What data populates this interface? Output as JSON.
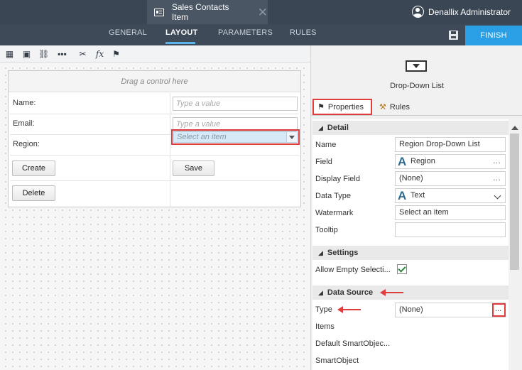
{
  "header": {
    "document_title": "Sales Contacts Item",
    "user_name": "Denallix Administrator"
  },
  "nav": {
    "tabs": [
      {
        "label": "GENERAL",
        "active": false
      },
      {
        "label": "LAYOUT",
        "active": true
      },
      {
        "label": "PARAMETERS",
        "active": false
      },
      {
        "label": "RULES",
        "active": false
      }
    ],
    "finish_label": "FINISH",
    "accent_color": "#2a9fe6"
  },
  "toolbar": {
    "icons": [
      "table-icon",
      "image-icon",
      "link-icon",
      "more-icon",
      "tools-icon",
      "fx-icon",
      "theme-icon"
    ],
    "fx_glyph": "fx"
  },
  "canvas": {
    "drop_hint": "Drag a control here",
    "fields": [
      {
        "label": "Name:",
        "placeholder": "Type a value"
      },
      {
        "label": "Email:",
        "placeholder": "Type a value"
      },
      {
        "label": "Region:",
        "placeholder": "Select an item"
      }
    ],
    "buttons": {
      "create": "Create",
      "save": "Save",
      "delete": "Delete"
    }
  },
  "panel": {
    "control_type": "Drop-Down List",
    "tabs": {
      "properties": "Properties",
      "rules": "Rules"
    },
    "sections": {
      "detail": "Detail",
      "settings": "Settings",
      "data_source": "Data Source"
    },
    "detail": [
      {
        "label": "Name",
        "value": "Region Drop-Down List"
      },
      {
        "label": "Field",
        "value": "Region",
        "glyph": "A"
      },
      {
        "label": "Display Field",
        "value": "(None)"
      },
      {
        "label": "Data Type",
        "value": "Text",
        "glyph": "A"
      },
      {
        "label": "Watermark",
        "value": "Select an item"
      },
      {
        "label": "Tooltip",
        "value": ""
      }
    ],
    "settings": [
      {
        "label": "Allow Empty Selecti...",
        "checked": true
      }
    ],
    "data_source": [
      {
        "label": "Type",
        "value": "(None)"
      },
      {
        "label": "Items"
      },
      {
        "label": "Default SmartObjec..."
      },
      {
        "label": "SmartObject"
      }
    ],
    "ellipsis": "...",
    "highlight_color": "#e03c3c"
  }
}
